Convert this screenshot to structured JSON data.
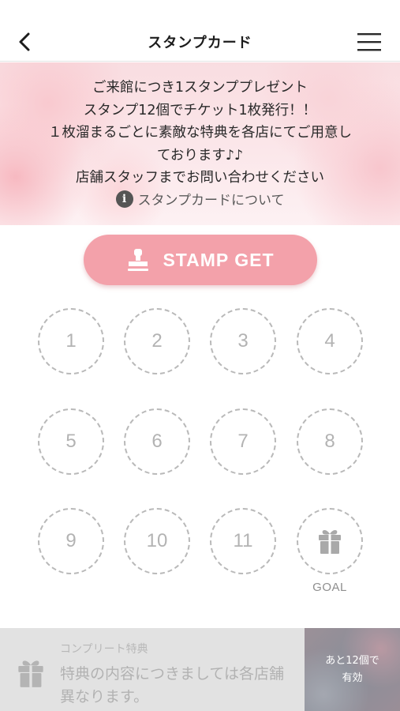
{
  "header": {
    "title": "スタンプカード",
    "back_icon": "chevron-left-icon",
    "menu_icon": "hamburger-menu-icon"
  },
  "banner": {
    "lines": [
      "ご来館につき1スタンププレゼント",
      "スタンプ12個でチケット1枚発行！！",
      "１枚溜まるごとに素敵な特典を各店にてご用意し",
      "ております♪♪",
      "店舗スタッフまでお問い合わせください"
    ],
    "about_icon": "info-icon",
    "about_icon_glyph": "i",
    "about_label": "スタンプカードについて"
  },
  "stamp_button": {
    "label": "STAMP GET",
    "icon": "stamp-icon",
    "color": "#f3a1aa"
  },
  "stamp_card": {
    "slots": [
      "1",
      "2",
      "3",
      "4",
      "5",
      "6",
      "7",
      "8",
      "9",
      "10",
      "11"
    ],
    "goal_icon": "gift-icon",
    "goal_label": "GOAL"
  },
  "reward": {
    "title": "コンプリート特典",
    "description": "特典の内容につきましては各店舗異なります。",
    "icon": "gift-icon",
    "remaining_line1": "あと12個で",
    "remaining_line2": "有効"
  }
}
